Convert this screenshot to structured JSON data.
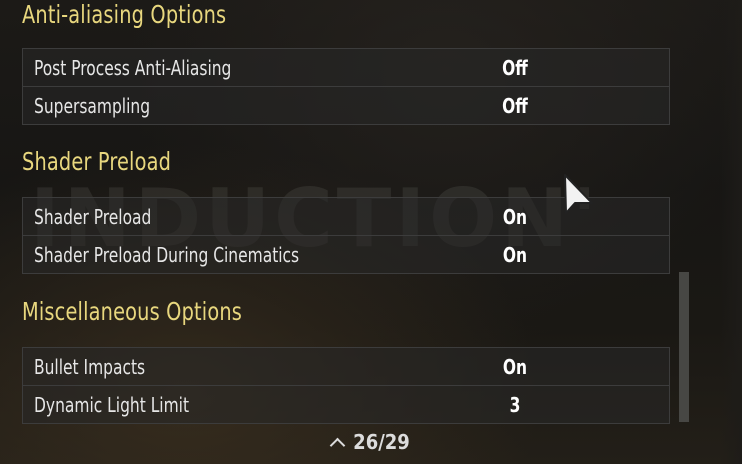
{
  "background": {
    "watermark": "INDUCTION'"
  },
  "sections": [
    {
      "title": "Anti-aliasing Options",
      "rows": [
        {
          "label": "Post Process Anti-Aliasing",
          "value": "Off"
        },
        {
          "label": "Supersampling",
          "value": "Off"
        }
      ]
    },
    {
      "title": "Shader Preload",
      "rows": [
        {
          "label": "Shader Preload",
          "value": "On"
        },
        {
          "label": "Shader Preload During Cinematics",
          "value": "On"
        }
      ]
    },
    {
      "title": "Miscellaneous Options",
      "rows": [
        {
          "label": "Bullet Impacts",
          "value": "On"
        },
        {
          "label": "Dynamic Light Limit",
          "value": "3"
        }
      ]
    }
  ],
  "pager": {
    "label": "26/29",
    "icon": "chevron-up-icon"
  },
  "colors": {
    "section_header": "#e8d77e",
    "row_text": "#e6e6e6",
    "value_text": "#ffffff",
    "row_border": "#3c3c3c",
    "scrollbar": "#474744"
  }
}
